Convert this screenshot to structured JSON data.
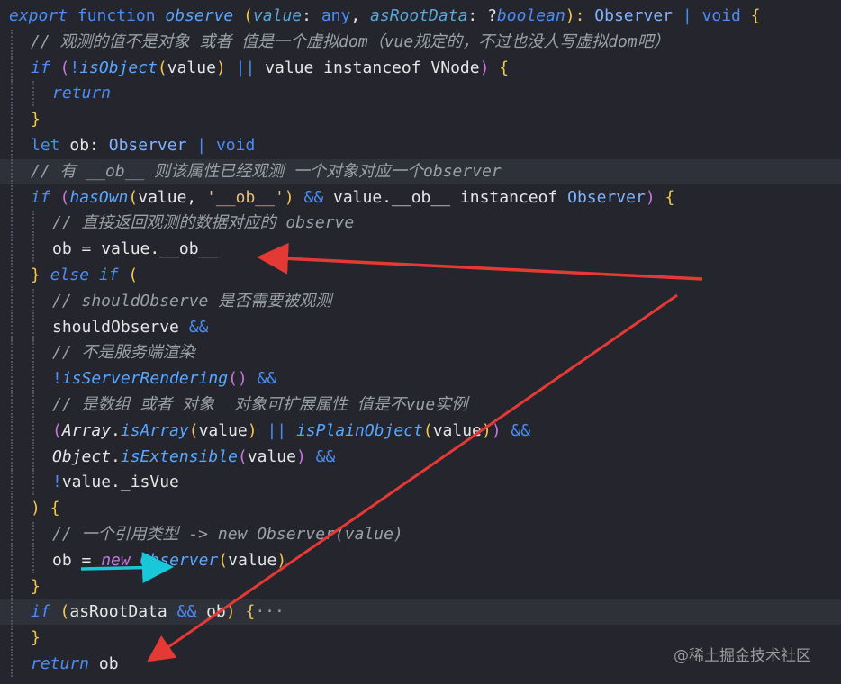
{
  "colors": {
    "background": "#24252d",
    "highlight_line": "#2e303a",
    "keyword": "#4b8df8",
    "function_name": "#58a6ff",
    "param": "#5aa6d6",
    "type": "#7fb3ff",
    "comment": "#9aa1a6",
    "string": "#e5c07b",
    "plain": "#e6e6e6",
    "bracket_yellow": "#f2c94c",
    "bracket_purple": "#c678dd",
    "annotation_red": "#e53935",
    "annotation_cyan": "#18c8d8"
  },
  "code_lines": [
    {
      "indent": 0,
      "highlight": false,
      "tokens": [
        {
          "t": "export ",
          "c": "keyword",
          "i": true
        },
        {
          "t": "function ",
          "c": "keyword"
        },
        {
          "t": "observe ",
          "c": "function_name",
          "i": true
        },
        {
          "t": "(",
          "c": "bracket_yellow"
        },
        {
          "t": "value",
          "c": "param",
          "i": true
        },
        {
          "t": ": ",
          "c": "plain"
        },
        {
          "t": "any",
          "c": "keyword"
        },
        {
          "t": ", ",
          "c": "plain"
        },
        {
          "t": "asRootData",
          "c": "param",
          "i": true
        },
        {
          "t": ": ?",
          "c": "plain"
        },
        {
          "t": "boolean",
          "c": "keyword",
          "i": true
        },
        {
          "t": "): ",
          "c": "bracket_yellow"
        },
        {
          "t": "Observer ",
          "c": "type"
        },
        {
          "t": "| ",
          "c": "keyword"
        },
        {
          "t": "void ",
          "c": "keyword"
        },
        {
          "t": "{",
          "c": "bracket_yellow"
        }
      ]
    },
    {
      "indent": 1,
      "highlight": false,
      "tokens": [
        {
          "t": "// 观测的值不是对象 或者 值是一个虚拟dom（vue规定的，不过也没人写虚拟dom吧）",
          "c": "comment",
          "i": true
        }
      ]
    },
    {
      "indent": 1,
      "highlight": false,
      "tokens": [
        {
          "t": "if ",
          "c": "keyword",
          "i": true
        },
        {
          "t": "(",
          "c": "bracket_purple"
        },
        {
          "t": "!",
          "c": "keyword"
        },
        {
          "t": "isObject",
          "c": "function_name",
          "i": true
        },
        {
          "t": "(",
          "c": "bracket_yellow"
        },
        {
          "t": "value",
          "c": "plain"
        },
        {
          "t": ") ",
          "c": "bracket_yellow"
        },
        {
          "t": "|| ",
          "c": "keyword"
        },
        {
          "t": "value ",
          "c": "plain"
        },
        {
          "t": "instanceof ",
          "c": "plain"
        },
        {
          "t": "VNode",
          "c": "plain"
        },
        {
          "t": ") ",
          "c": "bracket_purple"
        },
        {
          "t": "{",
          "c": "bracket_yellow"
        }
      ]
    },
    {
      "indent": 2,
      "highlight": false,
      "tokens": [
        {
          "t": "return",
          "c": "keyword",
          "i": true
        }
      ]
    },
    {
      "indent": 1,
      "highlight": false,
      "tokens": [
        {
          "t": "}",
          "c": "bracket_yellow"
        }
      ]
    },
    {
      "indent": 1,
      "highlight": false,
      "tokens": [
        {
          "t": "let ",
          "c": "keyword"
        },
        {
          "t": "ob",
          "c": "plain"
        },
        {
          "t": ": ",
          "c": "plain"
        },
        {
          "t": "Observer ",
          "c": "type"
        },
        {
          "t": "| ",
          "c": "keyword"
        },
        {
          "t": "void",
          "c": "keyword"
        }
      ]
    },
    {
      "indent": 1,
      "highlight": true,
      "tokens": [
        {
          "t": "// 有 __ob__ 则该属性已经观测 一个对象对应一个observer",
          "c": "comment",
          "i": true
        }
      ]
    },
    {
      "indent": 1,
      "highlight": false,
      "tokens": [
        {
          "t": "if ",
          "c": "keyword",
          "i": true
        },
        {
          "t": "(",
          "c": "bracket_purple"
        },
        {
          "t": "hasOwn",
          "c": "function_name",
          "i": true
        },
        {
          "t": "(",
          "c": "bracket_yellow"
        },
        {
          "t": "value, ",
          "c": "plain"
        },
        {
          "t": "'__ob__'",
          "c": "string"
        },
        {
          "t": ") ",
          "c": "bracket_yellow"
        },
        {
          "t": "&& ",
          "c": "keyword"
        },
        {
          "t": "value.__ob__ ",
          "c": "plain"
        },
        {
          "t": "instanceof ",
          "c": "plain"
        },
        {
          "t": "Observer",
          "c": "type"
        },
        {
          "t": ") ",
          "c": "bracket_purple"
        },
        {
          "t": "{",
          "c": "bracket_yellow"
        }
      ]
    },
    {
      "indent": 2,
      "highlight": false,
      "tokens": [
        {
          "t": "// 直接返回观测的数据对应的 observe",
          "c": "comment",
          "i": true
        }
      ]
    },
    {
      "indent": 2,
      "highlight": false,
      "tokens": [
        {
          "t": "ob ",
          "c": "plain"
        },
        {
          "t": "= ",
          "c": "plain"
        },
        {
          "t": "value.__ob__",
          "c": "plain"
        }
      ]
    },
    {
      "indent": 1,
      "highlight": false,
      "tokens": [
        {
          "t": "} ",
          "c": "bracket_yellow"
        },
        {
          "t": "else ",
          "c": "keyword",
          "i": true
        },
        {
          "t": "if ",
          "c": "keyword",
          "i": true
        },
        {
          "t": "(",
          "c": "bracket_yellow"
        }
      ]
    },
    {
      "indent": 2,
      "highlight": false,
      "tokens": [
        {
          "t": "// shouldObserve 是否需要被观测",
          "c": "comment",
          "i": true
        }
      ]
    },
    {
      "indent": 2,
      "highlight": false,
      "tokens": [
        {
          "t": "shouldObserve ",
          "c": "plain"
        },
        {
          "t": "&&",
          "c": "keyword"
        }
      ]
    },
    {
      "indent": 2,
      "highlight": false,
      "tokens": [
        {
          "t": "// 不是服务端渲染",
          "c": "comment",
          "i": true
        }
      ]
    },
    {
      "indent": 2,
      "highlight": false,
      "tokens": [
        {
          "t": "!",
          "c": "keyword"
        },
        {
          "t": "isServerRendering",
          "c": "function_name",
          "i": true
        },
        {
          "t": "() ",
          "c": "bracket_purple"
        },
        {
          "t": "&&",
          "c": "keyword"
        }
      ]
    },
    {
      "indent": 2,
      "highlight": false,
      "tokens": [
        {
          "t": "// 是数组 或者 对象  对象可扩展属性 值是不vue实例",
          "c": "comment",
          "i": true
        }
      ]
    },
    {
      "indent": 2,
      "highlight": false,
      "tokens": [
        {
          "t": "(",
          "c": "bracket_purple"
        },
        {
          "t": "Array",
          "c": "plain",
          "i": true
        },
        {
          "t": ".",
          "c": "plain"
        },
        {
          "t": "isArray",
          "c": "function_name",
          "i": true
        },
        {
          "t": "(",
          "c": "bracket_yellow"
        },
        {
          "t": "value",
          "c": "plain"
        },
        {
          "t": ") ",
          "c": "bracket_yellow"
        },
        {
          "t": "|| ",
          "c": "keyword"
        },
        {
          "t": "isPlainObject",
          "c": "function_name",
          "i": true
        },
        {
          "t": "(",
          "c": "bracket_yellow"
        },
        {
          "t": "value",
          "c": "plain"
        },
        {
          "t": ")",
          "c": "bracket_yellow"
        },
        {
          "t": ") ",
          "c": "bracket_purple"
        },
        {
          "t": "&&",
          "c": "keyword"
        }
      ]
    },
    {
      "indent": 2,
      "highlight": false,
      "tokens": [
        {
          "t": "Object",
          "c": "plain",
          "i": true
        },
        {
          "t": ".",
          "c": "plain"
        },
        {
          "t": "isExtensible",
          "c": "function_name",
          "i": true
        },
        {
          "t": "(",
          "c": "bracket_purple"
        },
        {
          "t": "value",
          "c": "plain"
        },
        {
          "t": ") ",
          "c": "bracket_purple"
        },
        {
          "t": "&&",
          "c": "keyword"
        }
      ]
    },
    {
      "indent": 2,
      "highlight": false,
      "tokens": [
        {
          "t": "!",
          "c": "keyword"
        },
        {
          "t": "value._isVue",
          "c": "plain"
        }
      ]
    },
    {
      "indent": 1,
      "highlight": false,
      "tokens": [
        {
          "t": ") ",
          "c": "bracket_yellow"
        },
        {
          "t": "{",
          "c": "bracket_yellow"
        }
      ]
    },
    {
      "indent": 2,
      "highlight": false,
      "tokens": [
        {
          "t": "// 一个引用类型 -> new Observer(value)",
          "c": "comment",
          "i": true
        }
      ]
    },
    {
      "indent": 2,
      "highlight": false,
      "tokens": [
        {
          "t": "ob ",
          "c": "plain"
        },
        {
          "t": "= ",
          "c": "plain"
        },
        {
          "t": "new ",
          "c": "bracket_purple",
          "i": true
        },
        {
          "t": "Observer",
          "c": "function_name",
          "i": true
        },
        {
          "t": "(",
          "c": "bracket_yellow"
        },
        {
          "t": "value",
          "c": "plain"
        },
        {
          "t": ")",
          "c": "bracket_yellow"
        }
      ]
    },
    {
      "indent": 1,
      "highlight": false,
      "tokens": [
        {
          "t": "}",
          "c": "bracket_yellow"
        }
      ]
    },
    {
      "indent": 1,
      "highlight": true,
      "tokens": [
        {
          "t": "if ",
          "c": "keyword",
          "i": true
        },
        {
          "t": "(",
          "c": "bracket_yellow"
        },
        {
          "t": "asRootData ",
          "c": "plain"
        },
        {
          "t": "&& ",
          "c": "keyword"
        },
        {
          "t": "ob",
          "c": "plain"
        },
        {
          "t": ") ",
          "c": "bracket_yellow"
        },
        {
          "t": "{",
          "c": "bracket_yellow"
        },
        {
          "t": "···",
          "c": "comment"
        }
      ]
    },
    {
      "indent": 1,
      "highlight": false,
      "tokens": [
        {
          "t": "}",
          "c": "bracket_yellow"
        }
      ]
    },
    {
      "indent": 1,
      "highlight": false,
      "tokens": [
        {
          "t": "return ",
          "c": "keyword",
          "i": true
        },
        {
          "t": "ob",
          "c": "plain"
        }
      ]
    }
  ],
  "watermark": "@稀土掘金技术社区",
  "annotations": [
    {
      "name": "red-arrow-to-ob-assignment",
      "color": "annotation_red"
    },
    {
      "name": "red-arrow-to-return-ob",
      "color": "annotation_red"
    },
    {
      "name": "cyan-arrow-to-new-observer",
      "color": "annotation_cyan"
    }
  ]
}
